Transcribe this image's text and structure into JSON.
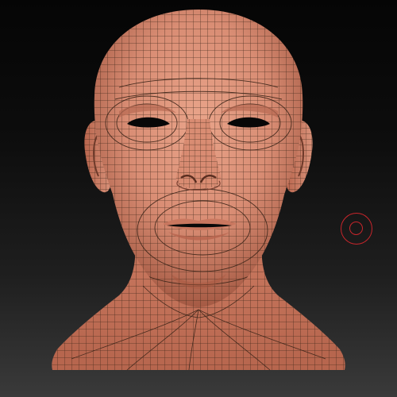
{
  "viewport": {
    "background_top": "#050505",
    "background_bottom": "#3a3a3a"
  },
  "model": {
    "kind": "head-bust",
    "shading": "skin-matcap",
    "wireframe_visible": true,
    "skin_color": "#d9927a",
    "wire_color": "#3a2418"
  },
  "brush_cursor": {
    "icon": "brush-cursor-icon",
    "color": "#c8252b"
  }
}
